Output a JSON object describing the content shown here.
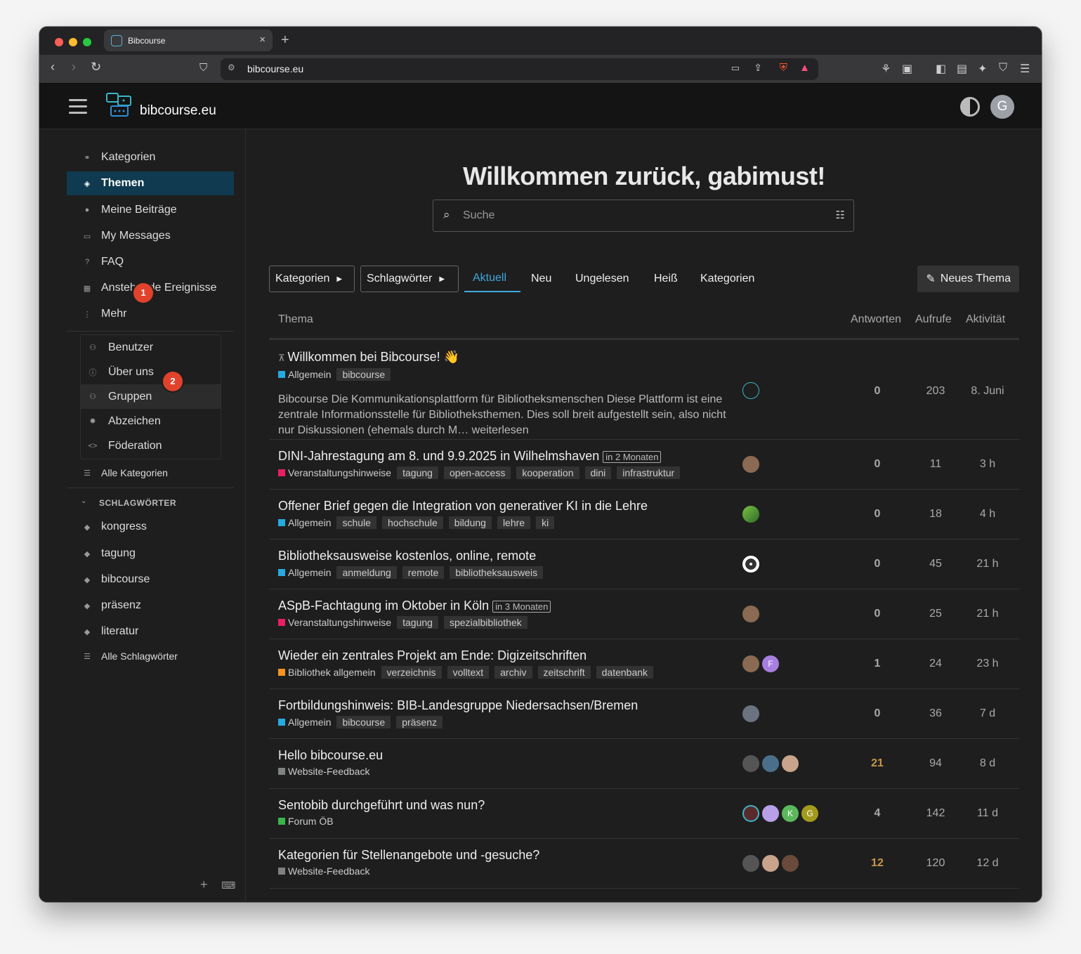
{
  "browser": {
    "tab_title": "Bibcourse",
    "url": "bibcourse.eu"
  },
  "header": {
    "site_name": "bibcourse.eu",
    "user_initial": "G"
  },
  "sidebar": {
    "items": [
      {
        "label": "Kategorien",
        "icon": "link-icon"
      },
      {
        "label": "Themen",
        "icon": "layers-icon"
      },
      {
        "label": "Meine Beiträge",
        "icon": "user-icon"
      },
      {
        "label": "My Messages",
        "icon": "inbox-icon"
      },
      {
        "label": "FAQ",
        "icon": "question-icon"
      },
      {
        "label": "Anstehende Ereignisse",
        "icon": "calendar-icon"
      },
      {
        "label": "Mehr",
        "icon": "ellipsis-icon"
      }
    ],
    "more_items": [
      {
        "label": "Benutzer",
        "icon": "users-icon"
      },
      {
        "label": "Über uns",
        "icon": "info-icon"
      },
      {
        "label": "Gruppen",
        "icon": "group-icon"
      },
      {
        "label": "Abzeichen",
        "icon": "badge-icon"
      },
      {
        "label": "Föderation",
        "icon": "federation-icon"
      }
    ],
    "all_categories": "Alle Kategorien",
    "tags_section": "SCHLAGWÖRTER",
    "tags": [
      "kongress",
      "tagung",
      "bibcourse",
      "präsenz",
      "literatur"
    ],
    "all_tags": "Alle Schlagwörter",
    "badge1": "1",
    "badge2": "2"
  },
  "main": {
    "welcome": "Willkommen zurück, gabimust!",
    "search_placeholder": "Suche",
    "nav": {
      "categories_dd": "Kategorien",
      "tags_dd": "Schlagwörter",
      "tabs": [
        "Aktuell",
        "Neu",
        "Ungelesen",
        "Heiß",
        "Kategorien"
      ],
      "new_topic": "Neues Thema"
    },
    "columns": {
      "topic": "Thema",
      "replies": "Antworten",
      "views": "Aufrufe",
      "activity": "Aktivität"
    }
  },
  "topics": [
    {
      "title": "Willkommen bei Bibcourse! 👋",
      "category": "Allgemein",
      "color": "#25aae1",
      "tags": [
        "bibcourse"
      ],
      "excerpt": "Bibcourse Die Kommunikationsplattform für Bibliotheksmenschen Diese Plattform ist eine zentrale Informationsstelle für Bibliotheksthemen. Dies soll breit aufgestellt sein, also nicht nur Diskussionen (ehemals durch M… weiterlesen",
      "replies": "0",
      "views": "203",
      "activity": "8. Juni"
    },
    {
      "title": "DINI-Jahrestagung am 8. und 9.9.2025 in Wilhelmshaven",
      "future": "in 2 Monaten",
      "category": "Veranstaltungshinweise",
      "color": "#e91e63",
      "tags": [
        "tagung",
        "open-access",
        "kooperation",
        "dini",
        "infrastruktur"
      ],
      "replies": "0",
      "views": "11",
      "activity": "3 h"
    },
    {
      "title": "Offener Brief gegen die Integration von generativer KI in die Lehre",
      "category": "Allgemein",
      "color": "#25aae1",
      "tags": [
        "schule",
        "hochschule",
        "bildung",
        "lehre",
        "ki"
      ],
      "replies": "0",
      "views": "18",
      "activity": "4 h"
    },
    {
      "title": "Bibliotheksausweise kostenlos, online, remote",
      "category": "Allgemein",
      "color": "#25aae1",
      "tags": [
        "anmeldung",
        "remote",
        "bibliotheksausweis"
      ],
      "replies": "0",
      "views": "45",
      "activity": "21 h"
    },
    {
      "title": "ASpB-Fachtagung im Oktober in Köln",
      "future": "in 3 Monaten",
      "category": "Veranstaltungshinweise",
      "color": "#e91e63",
      "tags": [
        "tagung",
        "spezialbibliothek"
      ],
      "replies": "0",
      "views": "25",
      "activity": "21 h"
    },
    {
      "title": "Wieder ein zentrales Projekt am Ende: Digizeitschriften",
      "category": "Bibliothek allgemein",
      "color": "#f7941d",
      "tags": [
        "verzeichnis",
        "volltext",
        "archiv",
        "zeitschrift",
        "datenbank"
      ],
      "replies": "1",
      "views": "24",
      "activity": "23 h"
    },
    {
      "title": "Fortbildungshinweis: BIB-Landesgruppe Niedersachsen/Bremen",
      "category": "Allgemein",
      "color": "#25aae1",
      "tags": [
        "bibcourse",
        "präsenz"
      ],
      "replies": "0",
      "views": "36",
      "activity": "7 d"
    },
    {
      "title": "Hello bibcourse.eu",
      "category": "Website-Feedback",
      "color": "#808281",
      "tags": [],
      "replies": "21",
      "views": "94",
      "activity": "8 d"
    },
    {
      "title": "Sentobib durchgeführt und was nun?",
      "category": "Forum ÖB",
      "color": "#3ab54a",
      "tags": [],
      "replies": "4",
      "views": "142",
      "activity": "11 d"
    },
    {
      "title": "Kategorien für Stellenangebote und -gesuche?",
      "category": "Website-Feedback",
      "color": "#808281",
      "tags": [],
      "replies": "12",
      "views": "120",
      "activity": "12 d"
    }
  ],
  "poster_initials": {
    "f": "F",
    "k": "K",
    "g": "G"
  }
}
